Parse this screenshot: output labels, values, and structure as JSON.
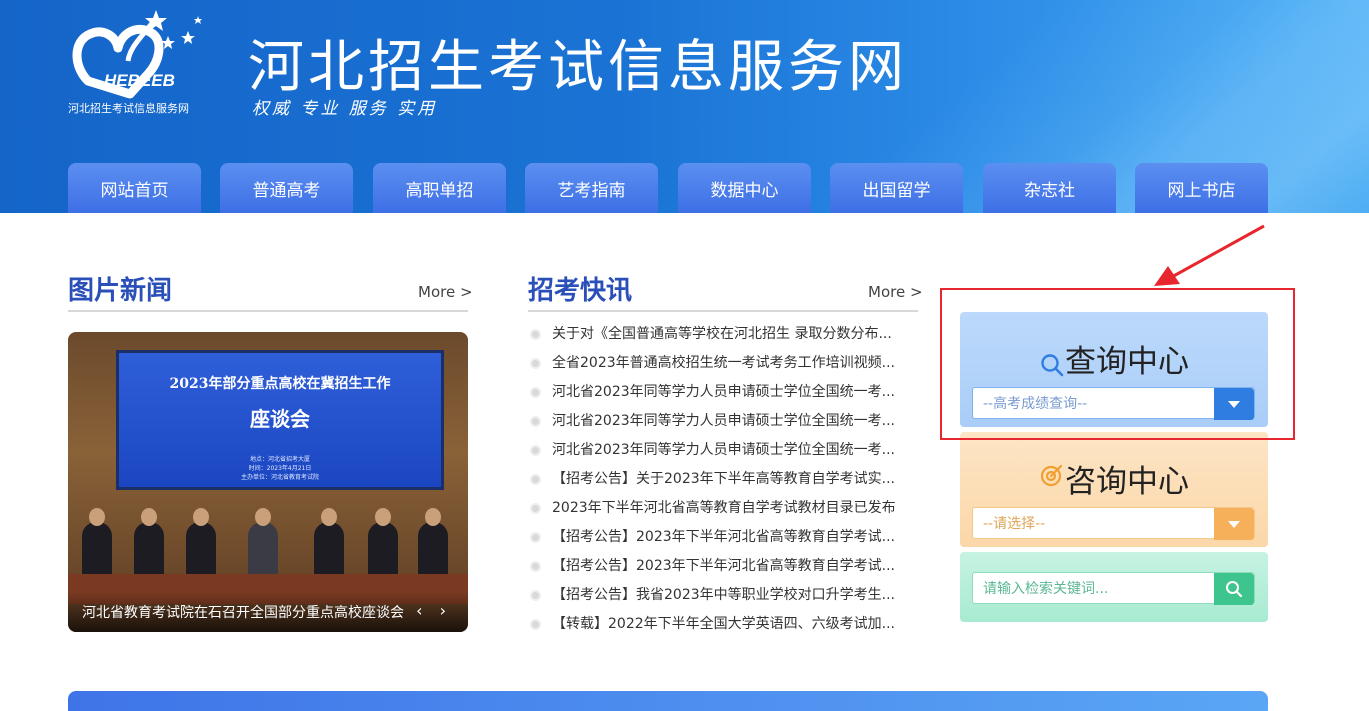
{
  "header": {
    "logo_text": "HEBEEB",
    "logo_subtitle": "河北招生考试信息服务网",
    "site_title": "河北招生考试信息服务网",
    "slogan": "权威 专业 服务 实用"
  },
  "nav": {
    "items": [
      "网站首页",
      "普通高考",
      "高职单招",
      "艺考指南",
      "数据中心",
      "出国留学",
      "杂志社",
      "网上书店"
    ]
  },
  "picture_news": {
    "title": "图片新闻",
    "more": "More >",
    "slide": {
      "screen_line1": "2023年部分重点高校在冀招生工作",
      "screen_line2": "座谈会",
      "screen_small_1": "地点：河北省招考大厦",
      "screen_small_2": "时间：2023年4月21日",
      "screen_small_3": "主办单位：河北省教育考试院",
      "caption": "河北省教育考试院在石召开全国部分重点高校座谈会",
      "arrows": "‹ ›"
    }
  },
  "express_news": {
    "title": "招考快讯",
    "more": "More >",
    "items": [
      "关于对《全国普通高等学校在河北招生 录取分数分布...",
      "全省2023年普通高校招生统一考试考务工作培训视频...",
      "河北省2023年同等学力人员申请硕士学位全国统一考...",
      "河北省2023年同等学力人员申请硕士学位全国统一考...",
      "河北省2023年同等学力人员申请硕士学位全国统一考...",
      "【招考公告】关于2023年下半年高等教育自学考试实...",
      "2023年下半年河北省高等教育自学考试教材目录已发布",
      "【招考公告】2023年下半年河北省高等教育自学考试...",
      "【招考公告】2023年下半年河北省高等教育自学考试...",
      "【招考公告】我省2023年中等职业学校对口升学考生...",
      "【转载】2022年下半年全国大学英语四、六级考试加..."
    ]
  },
  "query_center": {
    "title": "查询中心",
    "select_value": "--高考成绩查询--",
    "accent": "#2f7de0"
  },
  "consult_center": {
    "title": "咨询中心",
    "select_value": "--请选择--",
    "accent": "#f6b05a"
  },
  "search": {
    "placeholder": "请输入检索关键词...",
    "accent": "#3ec58e"
  },
  "annotation": {
    "box_color": "#e8262d"
  }
}
